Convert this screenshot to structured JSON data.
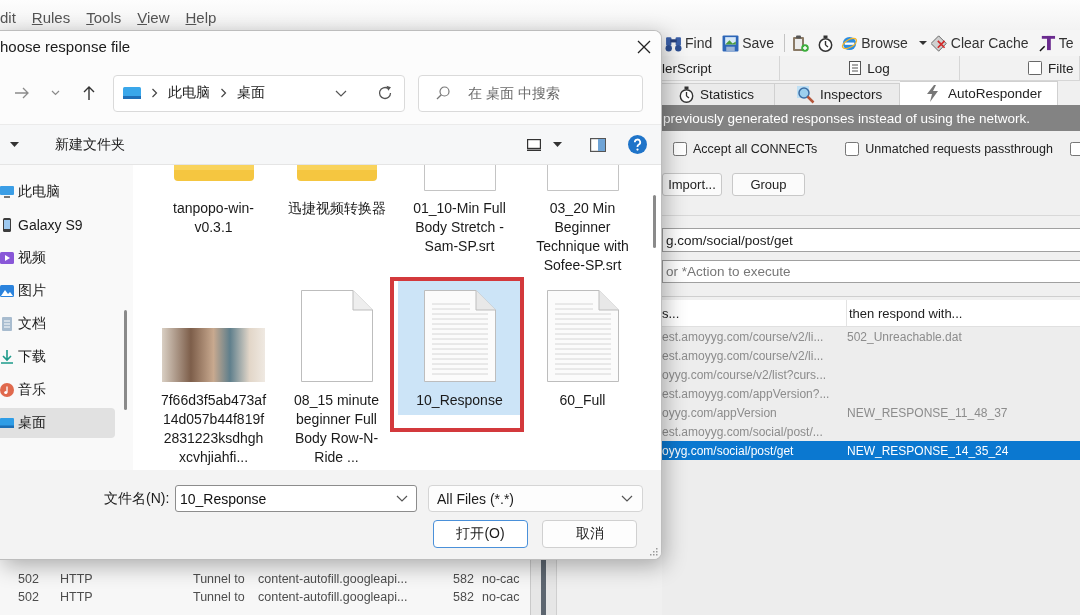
{
  "menu_bar": {
    "items": [
      {
        "label": "dit",
        "mnemonic": false
      },
      {
        "label": "Rules",
        "mnemonic": true
      },
      {
        "label": "Tools",
        "mnemonic": true
      },
      {
        "label": "View",
        "mnemonic": true
      },
      {
        "label": "Help",
        "mnemonic": true
      }
    ]
  },
  "toolbar": {
    "buttons": [
      {
        "label": "Find"
      },
      {
        "label": "Save"
      },
      {
        "label": "Browse"
      },
      {
        "label": "Clear Cache"
      },
      {
        "label": "Te"
      }
    ]
  },
  "sessions": {
    "rows": [
      {
        "cells": [
          "502",
          "HTTP",
          "Tunnel to",
          "content-autofill.googleapi...",
          "582",
          "no-cac"
        ]
      },
      {
        "cells": [
          "502",
          "HTTP",
          "Tunnel to",
          "content-autofill.googleapi...",
          "582",
          "no-cac"
        ]
      }
    ]
  },
  "inspector": {
    "tabs_top": [
      {
        "label": "lerScript",
        "selected": false
      },
      {
        "label": "Log",
        "selected": false
      },
      {
        "label": "Filte",
        "selected": false,
        "checked": false
      }
    ],
    "tabs": [
      {
        "label": "Statistics",
        "selected": false
      },
      {
        "label": "Inspectors",
        "selected": false
      },
      {
        "label": "AutoResponder",
        "selected": true
      }
    ]
  },
  "autoresponder": {
    "banner": "previously generated responses instead of using the network.",
    "options": [
      {
        "label": "Accept all CONNECTs",
        "checked": false
      },
      {
        "label": "Unmatched requests passthrough",
        "checked": false
      },
      {
        "checked": false
      }
    ],
    "buttons": [
      "Import...",
      "Group"
    ],
    "match_field": {
      "value": "g.com/social/post/get"
    },
    "action_field": {
      "placeholder": "or *Action to execute"
    },
    "rules": {
      "columns": [
        "s...",
        "then respond with..."
      ],
      "rows": [
        {
          "match": "est.amoyyg.com/course/v2/li...",
          "response": "502_Unreachable.dat",
          "selected": false
        },
        {
          "match": "est.amoyyg.com/course/v2/li...",
          "selected": false
        },
        {
          "match": "oyyg.com/course/v2/list?curs...",
          "selected": false
        },
        {
          "match": "est.amoyyg.com/appVersion?...",
          "selected": false
        },
        {
          "match": "oyyg.com/appVersion",
          "response": "NEW_RESPONSE_11_48_37",
          "selected": false
        },
        {
          "match": "est.amoyyg.com/social/post/...",
          "selected": false
        },
        {
          "match": "oyyg.com/social/post/get",
          "response": "NEW_RESPONSE_14_35_24",
          "selected": true
        }
      ]
    }
  },
  "dialog": {
    "title": "hoose response file",
    "breadcrumb": [
      "此电脑",
      "桌面"
    ],
    "search": {
      "placeholder": "在 桌面 中搜索"
    },
    "new_folder": "新建文件夹",
    "sidebar": [
      {
        "label": "此电脑",
        "selected": false
      },
      {
        "label": "Galaxy S9",
        "selected": false
      },
      {
        "label": "视频",
        "selected": false
      },
      {
        "label": "图片",
        "selected": false
      },
      {
        "label": "文档",
        "selected": false
      },
      {
        "label": "下载",
        "selected": false
      },
      {
        "label": "音乐",
        "selected": false
      },
      {
        "label": "桌面",
        "selected": true
      }
    ],
    "files": [
      {
        "name": "tanpopo-win-v0.3.1",
        "kind": "folder",
        "selected": false,
        "highlight": false
      },
      {
        "name": "迅捷视频转换器",
        "kind": "folder",
        "selected": false,
        "highlight": false
      },
      {
        "name": "01_10-Min Full Body Stretch - Sam-SP.srt",
        "kind": "file",
        "selected": false,
        "highlight": false
      },
      {
        "name": "03_20 Min Beginner Technique with Sofee-SP.srt",
        "kind": "file",
        "selected": false,
        "highlight": false
      },
      {
        "name": "7f66d3f5ab473af14d057b44f819f2831223ksdhghxcvhjiahfi...",
        "kind": "photo",
        "selected": false,
        "highlight": false
      },
      {
        "name": "08_15 minute beginner Full Body Row-N-Ride ...",
        "kind": "file",
        "selected": false,
        "highlight": false
      },
      {
        "name": "10_Response",
        "kind": "text",
        "selected": true,
        "highlight": true
      },
      {
        "name": "60_Full",
        "kind": "text",
        "selected": false,
        "highlight": false
      }
    ],
    "file_name": {
      "label": "文件名(N):",
      "value": "10_Response"
    },
    "file_type": {
      "value": "All Files (*.*)"
    },
    "buttons": [
      {
        "label": "打开(O)",
        "default": true
      },
      {
        "label": "取消",
        "default": false
      }
    ]
  }
}
